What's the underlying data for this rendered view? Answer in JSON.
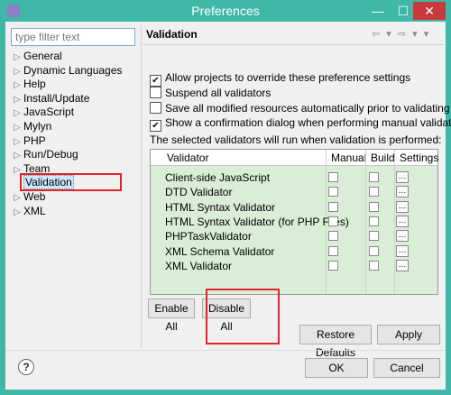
{
  "window": {
    "title": "Preferences",
    "min": "—",
    "max": "☐",
    "close": "✕"
  },
  "filter": {
    "placeholder": "type filter text"
  },
  "tree": {
    "items": [
      {
        "label": "General",
        "expandable": true
      },
      {
        "label": "Dynamic Languages",
        "expandable": true
      },
      {
        "label": "Help",
        "expandable": true
      },
      {
        "label": "Install/Update",
        "expandable": true
      },
      {
        "label": "JavaScript",
        "expandable": true
      },
      {
        "label": "Mylyn",
        "expandable": true
      },
      {
        "label": "PHP",
        "expandable": true
      },
      {
        "label": "Run/Debug",
        "expandable": true
      },
      {
        "label": "Team",
        "expandable": true
      },
      {
        "label": "Validation",
        "expandable": false,
        "selected": true
      },
      {
        "label": "Web",
        "expandable": true
      },
      {
        "label": "XML",
        "expandable": true
      }
    ]
  },
  "page": {
    "title": "Validation",
    "nav": "⇦ ▾ ⇨ ▾ ▾"
  },
  "options": [
    {
      "label": "Allow projects to override these preference settings",
      "checked": true
    },
    {
      "label": "Suspend all validators",
      "checked": false
    },
    {
      "label": "Save all modified resources automatically prior to validating",
      "checked": false
    },
    {
      "label": "Show a confirmation dialog when performing manual validations",
      "checked": true
    }
  ],
  "info": "The selected validators will run when validation is performed:",
  "table": {
    "headers": [
      "Validator",
      "Manual",
      "Build",
      "Settings"
    ],
    "rows": [
      {
        "name": "Client-side JavaScript"
      },
      {
        "name": "DTD Validator"
      },
      {
        "name": "HTML Syntax Validator"
      },
      {
        "name": "HTML Syntax Validator (for PHP Files)"
      },
      {
        "name": "PHPTaskValidator"
      },
      {
        "name": "XML Schema Validator"
      },
      {
        "name": "XML Validator"
      }
    ],
    "settings_glyph": "…"
  },
  "buttons": {
    "enable_all": "Enable All",
    "disable_all": "Disable All",
    "restore_defaults": "Restore Defaults",
    "apply": "Apply",
    "ok": "OK",
    "cancel": "Cancel",
    "help": "?"
  },
  "colors": {
    "title_bar": "#3fb8a8",
    "close_button": "#c9393b",
    "table_bg": "#daeed7",
    "annotation": "#e0242a"
  }
}
